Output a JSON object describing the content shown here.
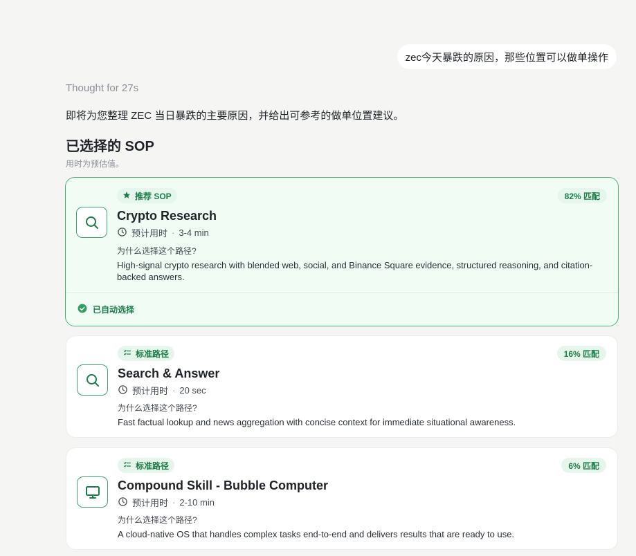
{
  "chat": {
    "user_message": "zec今天暴跌的原因，那些位置可以做单操作",
    "thought": "Thought for 27s",
    "intro": "即将为您整理 ZEC 当日暴跌的主要原因，并给出可参考的做单位置建议。"
  },
  "section": {
    "title": "已选择的 SOP",
    "subtitle": "用时为预估值。"
  },
  "cards": [
    {
      "tag": "推荐 SOP",
      "tag_icon": "star-icon",
      "match": "82% 匹配",
      "icon": "search-icon",
      "title": "Crypto Research",
      "time_label": "预计用时",
      "separator": "·",
      "time_value": "3-4 min",
      "why": "为什么选择这个路径?",
      "desc": "High-signal crypto research with blended web, social, and Binance Square evidence, structured reasoning, and citation-backed answers.",
      "footer": "已自动选择"
    },
    {
      "tag": "标准路径",
      "tag_icon": "checklist-icon",
      "match": "16% 匹配",
      "icon": "search-icon",
      "title": "Search & Answer",
      "time_label": "预计用时",
      "separator": "·",
      "time_value": "20 sec",
      "why": "为什么选择这个路径?",
      "desc": "Fast factual lookup and news aggregation with concise context for immediate situational awareness."
    },
    {
      "tag": "标准路径",
      "tag_icon": "checklist-icon",
      "match": "6% 匹配",
      "icon": "monitor-icon",
      "title": "Compound Skill - Bubble Computer",
      "time_label": "预计用时",
      "separator": "·",
      "time_value": "2-10 min",
      "why": "为什么选择这个路径?",
      "desc": "A cloud-native OS that handles complex tasks end-to-end and delivers results that are ready to use."
    }
  ],
  "colors": {
    "accent": "#1c7d48",
    "accent_border": "#4fae78",
    "selected_bg": "#f1fcf5",
    "page_bg": "#f5f5f4"
  }
}
